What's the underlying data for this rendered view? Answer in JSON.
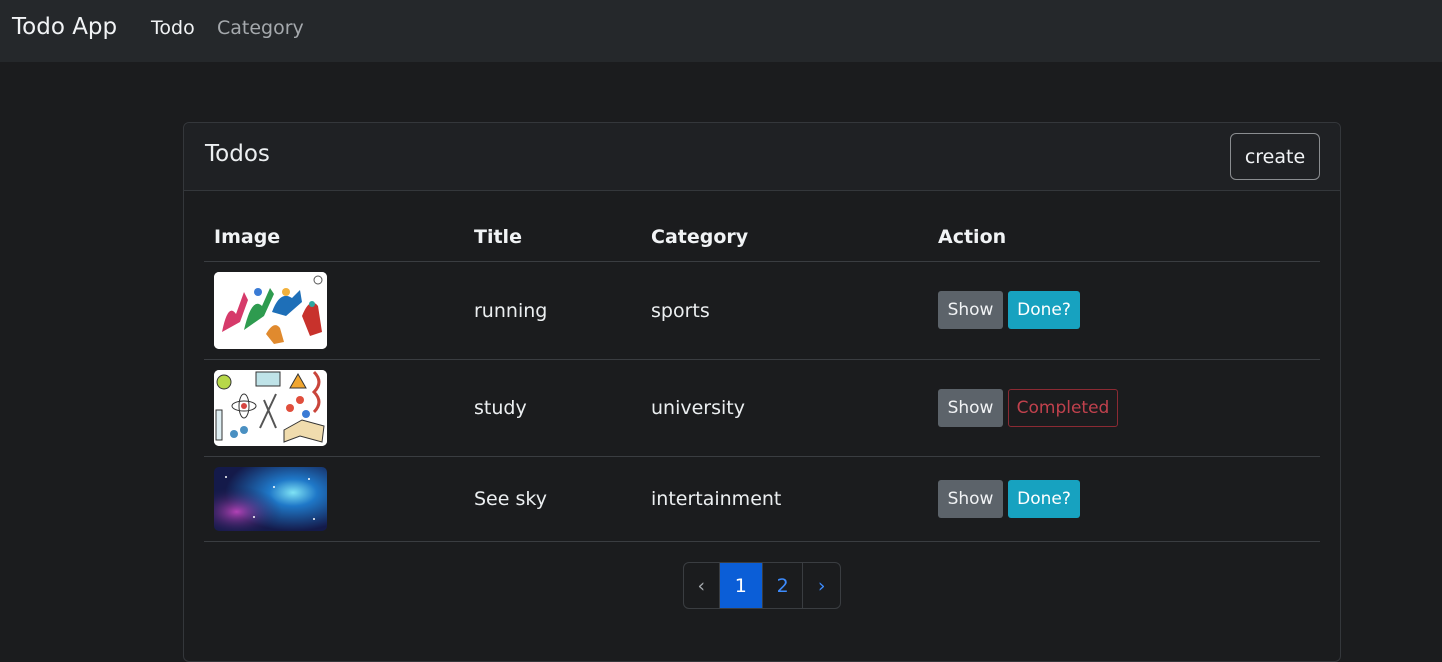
{
  "navbar": {
    "brand": "Todo App",
    "links": [
      "Todo",
      "Category"
    ]
  },
  "card": {
    "title": "Todos",
    "create_label": "create"
  },
  "table": {
    "headers": [
      "Image",
      "Title",
      "Category",
      "Action"
    ],
    "rows": [
      {
        "title": "running",
        "category": "sports",
        "show_label": "Show",
        "status_label": "Done?",
        "status": "pending"
      },
      {
        "title": "study",
        "category": "university",
        "show_label": "Show",
        "status_label": "Completed",
        "status": "completed"
      },
      {
        "title": "See sky",
        "category": "intertainment",
        "show_label": "Show",
        "status_label": "Done?",
        "status": "pending"
      }
    ]
  },
  "pagination": {
    "prev": "‹",
    "pages": [
      "1",
      "2"
    ],
    "next": "›",
    "active_page": "1"
  },
  "colors": {
    "background": "#1b1c1e",
    "navbar": "#25282b",
    "done_button": "#17a2c0",
    "completed_border": "#8b2a33",
    "active_page": "#0b5ed7"
  }
}
